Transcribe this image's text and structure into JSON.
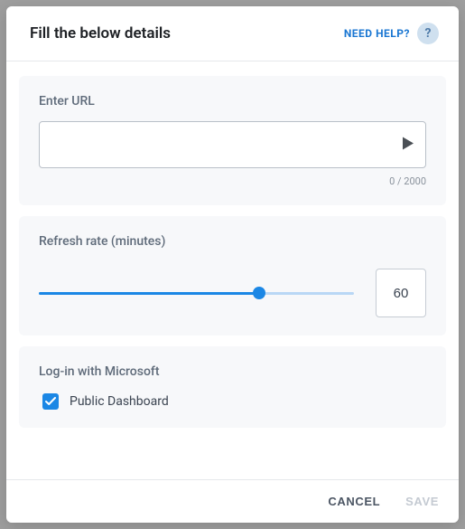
{
  "header": {
    "title": "Fill the below details",
    "help_label": "NEED HELP?",
    "help_glyph": "?"
  },
  "url_section": {
    "label": "Enter URL",
    "value": "",
    "placeholder": "",
    "counter": "0 / 2000"
  },
  "refresh_section": {
    "label": "Refresh rate (minutes)",
    "value": "60",
    "slider_percent": 70
  },
  "login_section": {
    "label": "Log-in with Microsoft",
    "checkbox_label": "Public Dashboard",
    "checked": true
  },
  "footer": {
    "cancel": "CANCEL",
    "save": "SAVE"
  }
}
